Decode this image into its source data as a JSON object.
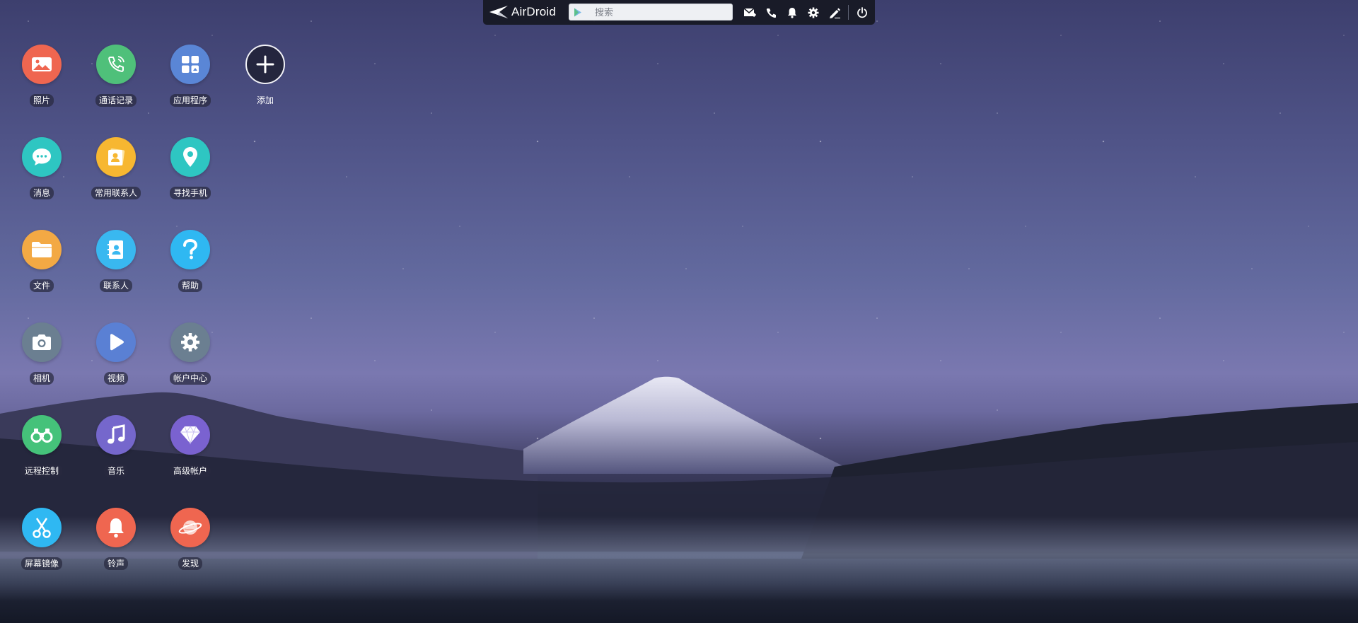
{
  "topbar": {
    "logo_text": "AirDroid",
    "search_placeholder": "搜索",
    "icons": [
      "mail-icon",
      "phone-icon",
      "bell-icon",
      "gear-icon",
      "pen-icon",
      "power-icon"
    ]
  },
  "apps": [
    {
      "label": "照片",
      "icon": "photo-icon",
      "color": "#ef6650"
    },
    {
      "label": "通话记录",
      "icon": "call-log-icon",
      "color": "#4fc07a"
    },
    {
      "label": "应用程序",
      "icon": "apps-icon",
      "color": "#5a86d6"
    },
    {
      "label": "添加",
      "icon": "plus-icon",
      "color": "#2b2c44"
    },
    {
      "label": "消息",
      "icon": "message-icon",
      "color": "#2ec6c2"
    },
    {
      "label": "常用联系人",
      "icon": "favorite-contacts-icon",
      "color": "#f7b731"
    },
    {
      "label": "寻找手机",
      "icon": "location-pin-icon",
      "color": "#2ec6c2"
    },
    {
      "label": "文件",
      "icon": "folder-icon",
      "color": "#f3a944"
    },
    {
      "label": "联系人",
      "icon": "contacts-book-icon",
      "color": "#39b8f0"
    },
    {
      "label": "帮助",
      "icon": "question-icon",
      "color": "#2fb8f2"
    },
    {
      "label": "相机",
      "icon": "camera-icon",
      "color": "#6b7f91"
    },
    {
      "label": "视频",
      "icon": "video-play-icon",
      "color": "#5a80d4"
    },
    {
      "label": "帐户中心",
      "icon": "settings-gear-icon",
      "color": "#6b7f91"
    },
    {
      "label": "远程控制",
      "icon": "binoculars-icon",
      "color": "#45c27a"
    },
    {
      "label": "音乐",
      "icon": "music-note-icon",
      "color": "#7567cc"
    },
    {
      "label": "高级帐户",
      "icon": "diamond-icon",
      "color": "#7a62d0"
    },
    {
      "label": "屏幕镜像",
      "icon": "scissors-icon",
      "color": "#2fb8f2"
    },
    {
      "label": "铃声",
      "icon": "ringtone-bell-icon",
      "color": "#ef6650"
    },
    {
      "label": "发现",
      "icon": "planet-icon",
      "color": "#ef6650"
    }
  ]
}
